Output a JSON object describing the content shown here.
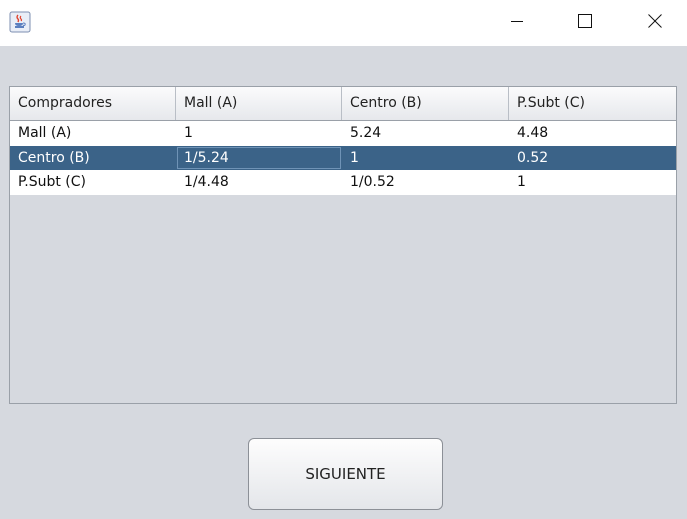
{
  "window": {
    "icon": "java-cup-icon",
    "controls": {
      "minimize_icon": "minimize-icon",
      "maximize_icon": "maximize-icon",
      "close_icon": "close-icon"
    }
  },
  "table": {
    "columns": [
      "Compradores",
      "Mall (A)",
      "Centro (B)",
      "P.Subt (C)"
    ],
    "rows": [
      [
        "Mall (A)",
        "1",
        "5.24",
        "4.48"
      ],
      [
        "Centro (B)",
        "1/5.24",
        "1",
        "0.52"
      ],
      [
        "P.Subt (C)",
        "1/4.48",
        "1/0.52",
        "1"
      ]
    ],
    "selected_row": 1,
    "focused_cell": [
      1,
      1
    ],
    "colors": {
      "selection": "#3b6388",
      "selection_text": "#ffffff",
      "row_background": "#ffffff"
    }
  },
  "buttons": {
    "next_label": "SIGUIENTE"
  }
}
